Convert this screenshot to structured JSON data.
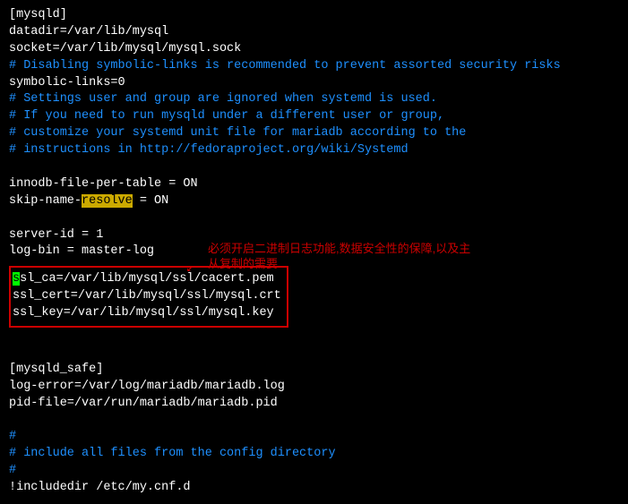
{
  "config": {
    "section1": "[mysqld]",
    "datadir": "datadir=/var/lib/mysql",
    "socket": "socket=/var/lib/mysql/mysql.sock",
    "comment1": "# Disabling symbolic-links is recommended to prevent assorted security risks",
    "symlinks": "symbolic-links=0",
    "comment2": "# Settings user and group are ignored when systemd is used.",
    "comment3": "# If you need to run mysqld under a different user or group,",
    "comment4": "# customize your systemd unit file for mariadb according to the",
    "comment5": "# instructions in http://fedoraproject.org/wiki/Systemd",
    "innodb": "innodb-file-per-table = ON",
    "skip_pre": "skip-name-",
    "skip_hl": "resolve",
    "skip_post": " = ON",
    "serverid": "server-id = 1",
    "logbin": "log-bin = master-log",
    "ssl_ca_first": "s",
    "ssl_ca_rest": "sl_ca=/var/lib/mysql/ssl/cacert.pem",
    "ssl_cert": "ssl_cert=/var/lib/mysql/ssl/mysql.crt",
    "ssl_key": "ssl_key=/var/lib/mysql/ssl/mysql.key",
    "section2": "[mysqld_safe]",
    "logerror": "log-error=/var/log/mariadb/mariadb.log",
    "pidfile": "pid-file=/var/run/mariadb/mariadb.pid",
    "comment6": "#",
    "comment7": "# include all files from the config directory",
    "comment8": "#",
    "includedir": "!includedir /etc/my.cnf.d"
  },
  "annotation": {
    "line1": "必须开启二进制日志功能,数据安全性的保障,以及主",
    "line2": "从复制的需要",
    "arrow": "↙"
  }
}
